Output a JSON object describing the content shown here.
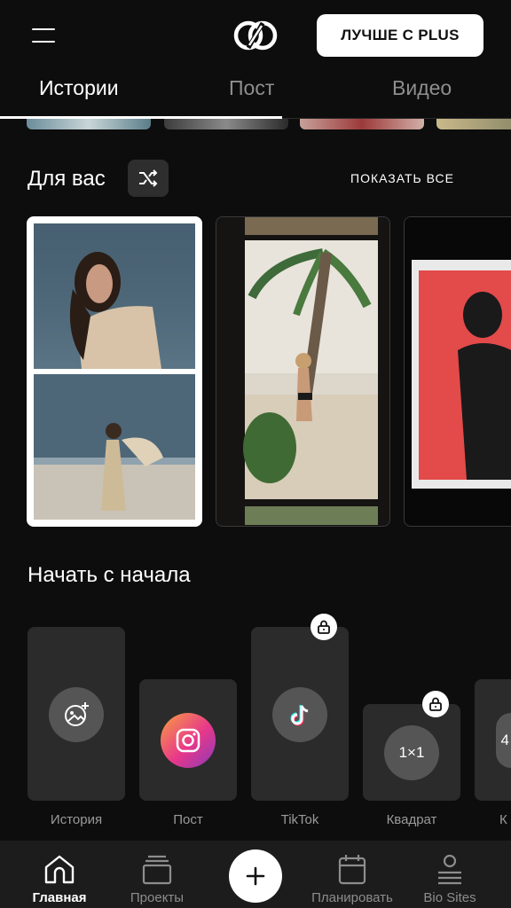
{
  "header": {
    "plus_button": "ЛУЧШЕ С PLUS"
  },
  "tabs": [
    {
      "label": "Истории",
      "active": true
    },
    {
      "label": "Пост",
      "active": false
    },
    {
      "label": "Видео",
      "active": false
    }
  ],
  "for_you": {
    "title": "Для вас",
    "show_all": "ПОКАЗАТЬ ВСЕ",
    "shuffle_icon": "shuffle-icon"
  },
  "start": {
    "title": "Начать с начала",
    "tiles": [
      {
        "label": "История",
        "icon": "add-photo-icon",
        "locked": false
      },
      {
        "label": "Пост",
        "icon": "instagram-icon",
        "locked": false
      },
      {
        "label": "TikTok",
        "icon": "tiktok-icon",
        "locked": true
      },
      {
        "label": "Квадрат",
        "icon_text": "1×1",
        "locked": true
      },
      {
        "label": "К",
        "icon_text": "4",
        "locked": false
      }
    ]
  },
  "bottom_nav": [
    {
      "label": "Главная",
      "icon": "home-icon",
      "active": true
    },
    {
      "label": "Проекты",
      "icon": "projects-icon",
      "active": false
    },
    {
      "label": "Планировать",
      "icon": "calendar-icon",
      "active": false
    },
    {
      "label": "Bio Sites",
      "icon": "bio-sites-icon",
      "active": false
    }
  ],
  "colors": {
    "background": "#0d0d0d",
    "accent": "#ffffff",
    "tile": "#2b2b2b",
    "nav_bg": "#1c1c1c",
    "instagram_gradient": [
      "#f9a03f",
      "#e8388a",
      "#8a3ab9"
    ]
  }
}
